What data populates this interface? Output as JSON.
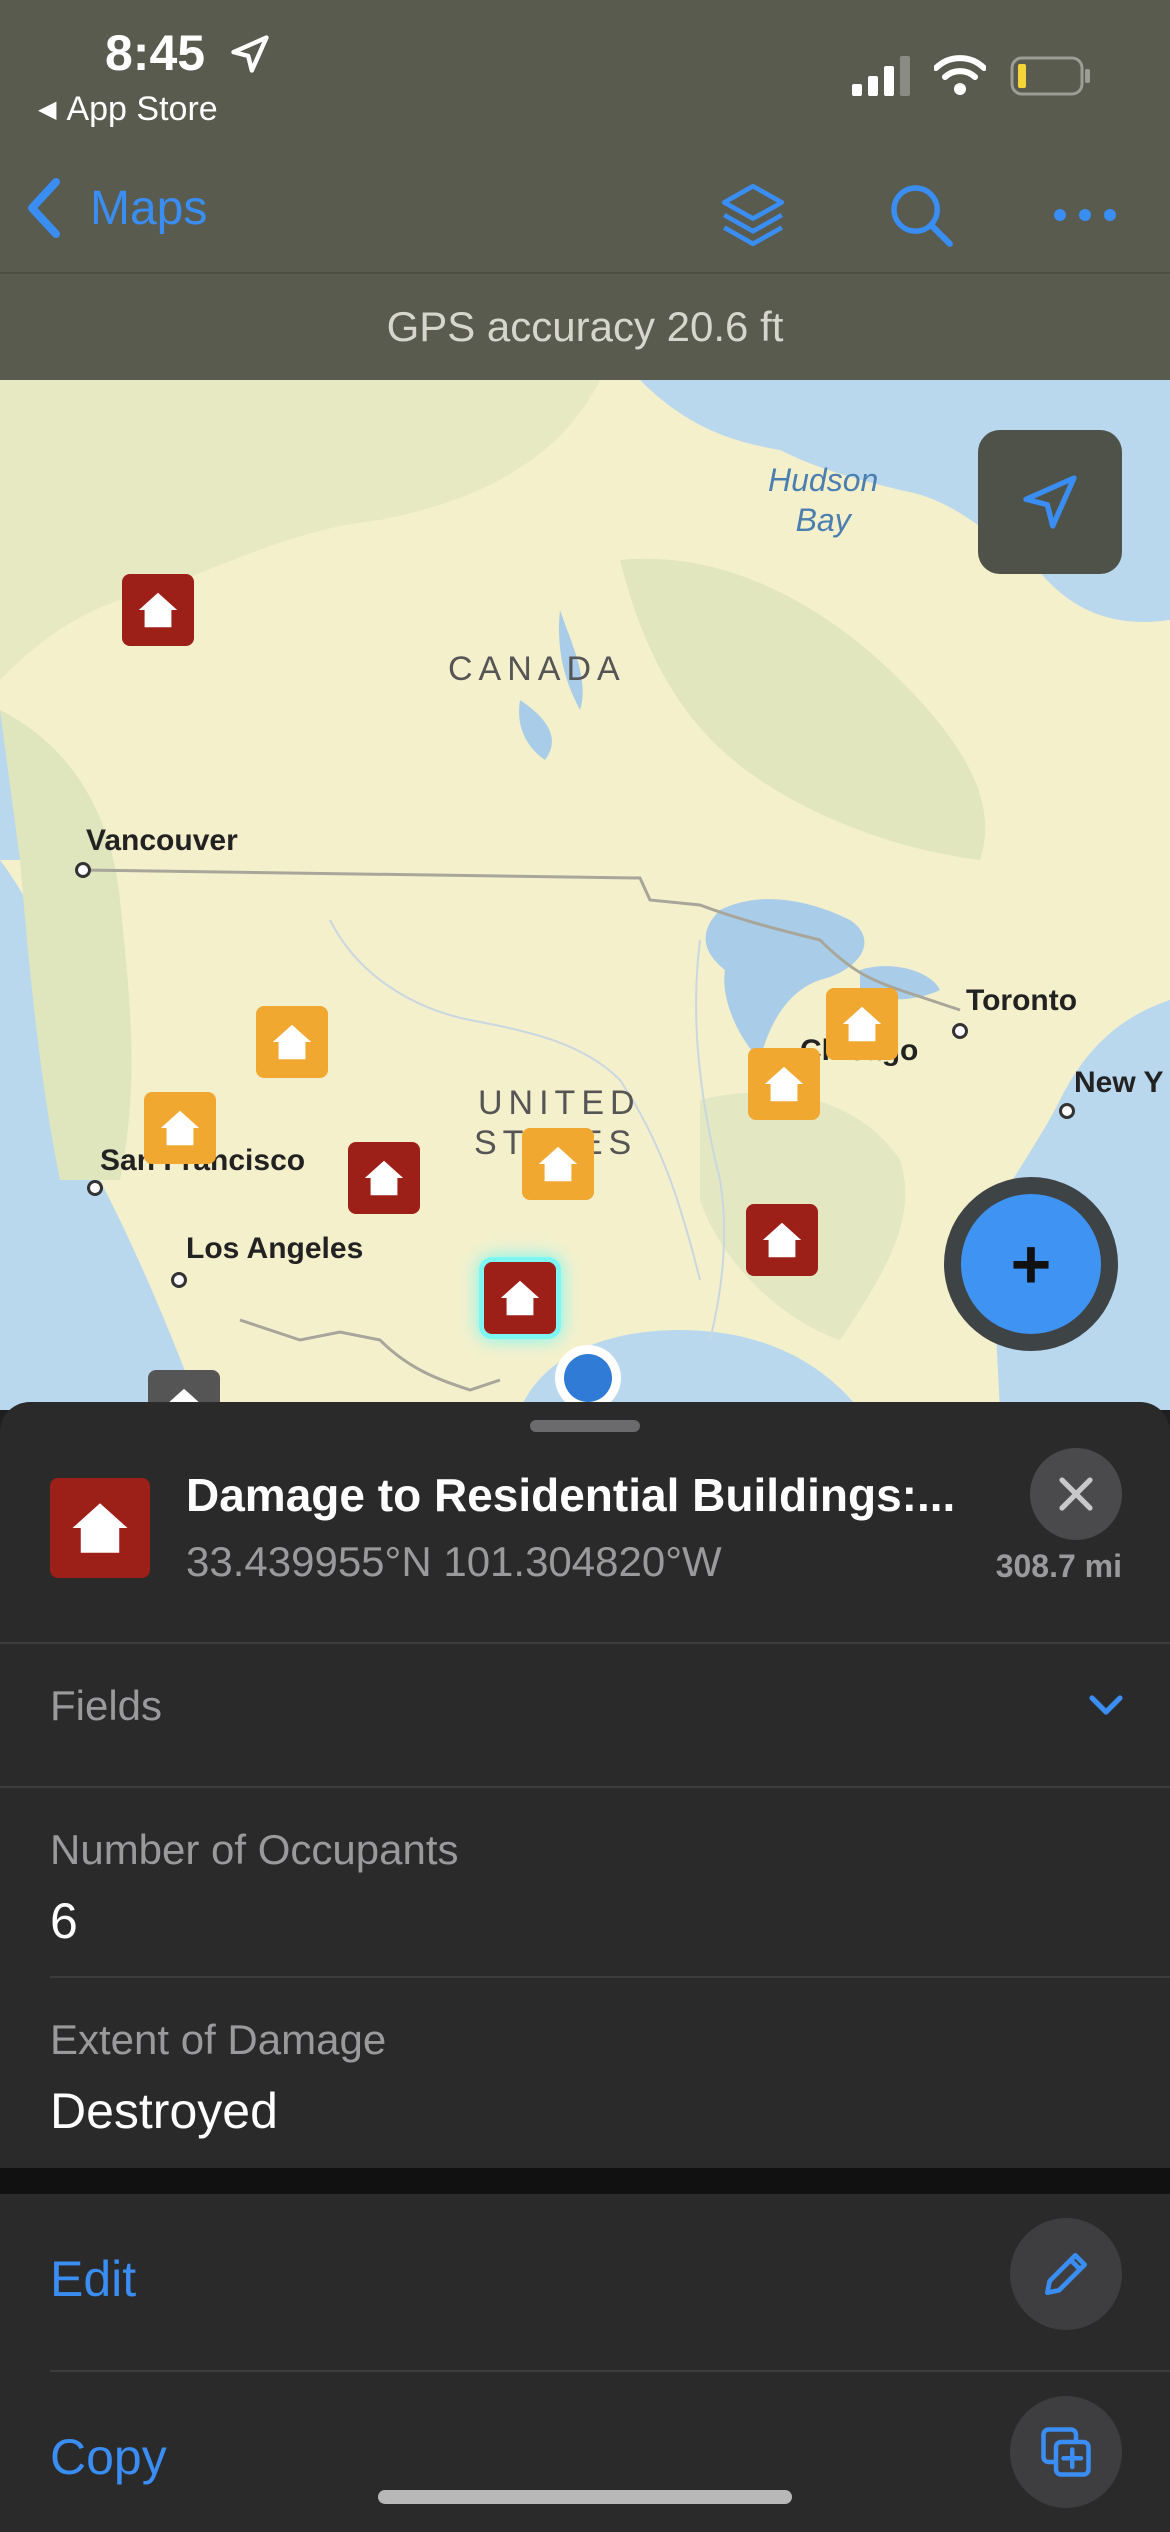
{
  "status": {
    "time": "8:45",
    "back_app": "App Store"
  },
  "nav": {
    "back_label": "Maps"
  },
  "gps_accuracy": "GPS accuracy 20.6 ft",
  "map": {
    "water_labels": [
      "Hudson\nBay"
    ],
    "country_labels": {
      "canada": "CANADA",
      "us_line1": "UNITED",
      "us_line2": "STATES"
    },
    "cities": {
      "vancouver": "Vancouver",
      "san_francisco": "San Francisco",
      "los_angeles": "Los Angeles",
      "toronto": "Toronto",
      "chicago": "Chicago",
      "new_york": "New Y"
    }
  },
  "feature": {
    "title": "Damage to Residential Buildings:...",
    "coords": "33.439955°N  101.304820°W",
    "distance": "308.7 mi"
  },
  "fields_section": {
    "label": "Fields"
  },
  "fields": [
    {
      "name": "Number of Occupants",
      "value": "6"
    },
    {
      "name": "Extent of Damage",
      "value": "Destroyed"
    }
  ],
  "actions": {
    "edit": "Edit",
    "copy": "Copy"
  },
  "colors": {
    "accent": "#3a8df2",
    "destroyed": "#9c1f18",
    "damaged": "#f0a830",
    "sheet": "#2a2a2b"
  }
}
